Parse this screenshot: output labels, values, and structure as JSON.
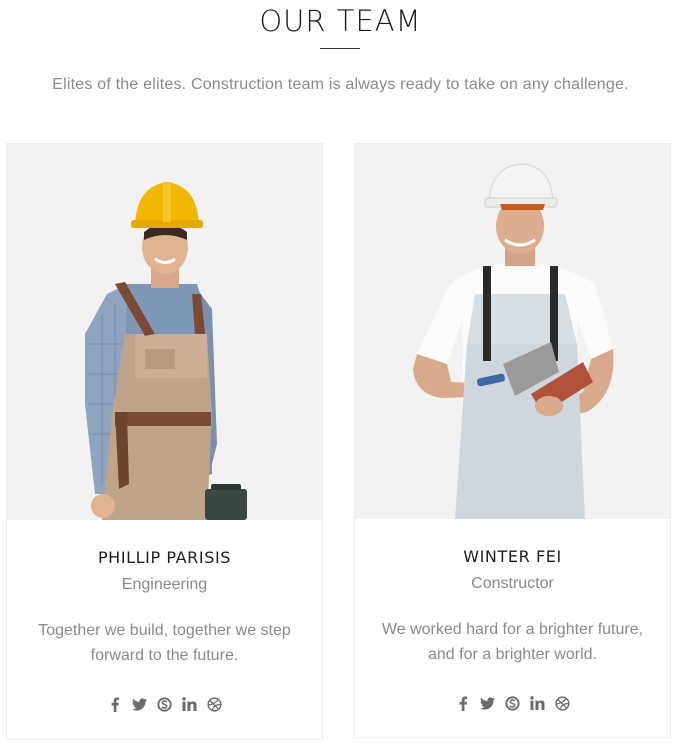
{
  "section": {
    "title": "OUR TEAM",
    "subtitle": "Elites of the elites. Construction team is always ready to take on any challenge."
  },
  "team": [
    {
      "name": "PHILLIP PARISIS",
      "role": "Engineering",
      "bio": "Together we build, together we step forward to the future.",
      "socials": [
        "facebook-icon",
        "twitter-icon",
        "skype-icon",
        "linkedin-icon",
        "dribbble-icon"
      ]
    },
    {
      "name": "WINTER FEI",
      "role": "Constructor",
      "bio": "We worked hard for a brighter future, and for a brighter world.",
      "socials": [
        "facebook-icon",
        "twitter-icon",
        "skype-icon",
        "linkedin-icon",
        "dribbble-icon"
      ]
    }
  ],
  "colors": {
    "heading": "#1b1b1b",
    "muted_text": "#8a8a8a",
    "photo_bg": "#f2f2f2",
    "icon": "#6b6b6b",
    "card_border": "#ececec"
  }
}
